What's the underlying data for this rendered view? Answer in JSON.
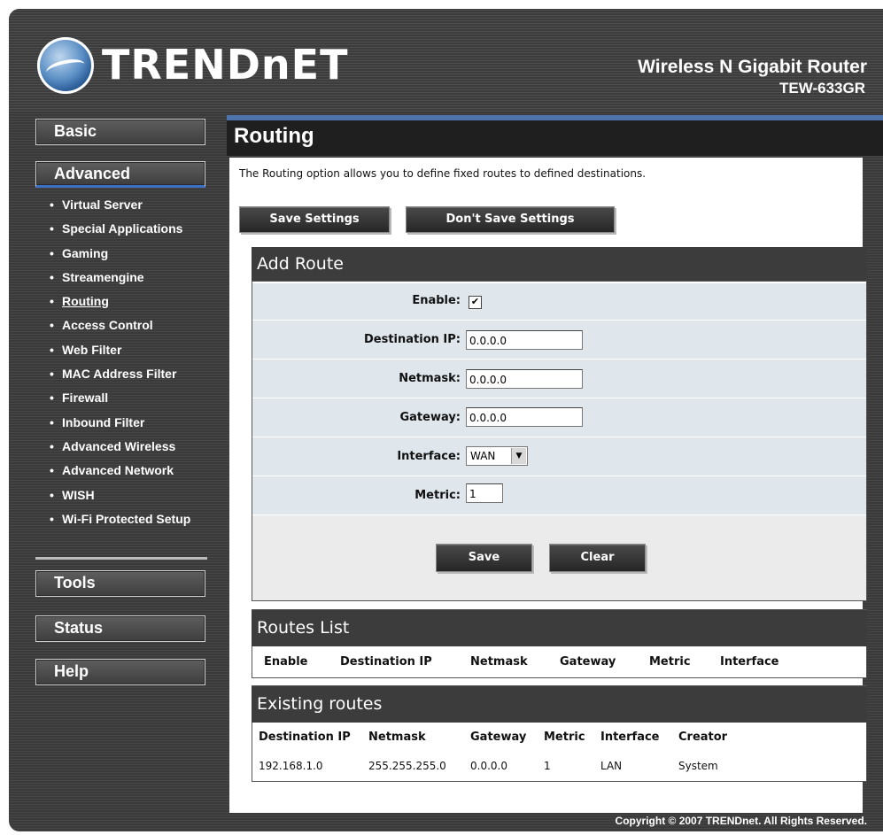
{
  "brand": {
    "logo_text": "TRENDnET",
    "product_title": "Wireless N Gigabit Router",
    "model": "TEW-633GR"
  },
  "nav": {
    "basic": "Basic",
    "advanced": "Advanced",
    "tools": "Tools",
    "status": "Status",
    "help": "Help",
    "advanced_items": [
      "Virtual Server",
      "Special Applications",
      "Gaming",
      "Streamengine",
      "Routing",
      "Access Control",
      "Web Filter",
      "MAC Address Filter",
      "Firewall",
      "Inbound Filter",
      "Advanced Wireless",
      "Advanced Network",
      "WISH",
      "Wi-Fi Protected Setup"
    ],
    "current_item": "Routing"
  },
  "page": {
    "title": "Routing",
    "intro": "The Routing option allows you to define fixed routes to defined destinations.",
    "save_settings": "Save Settings",
    "dont_save_settings": "Don't Save Settings"
  },
  "add_route": {
    "title": "Add Route",
    "enable_label": "Enable:",
    "enable_checked": true,
    "dest_label": "Destination IP:",
    "dest_value": "0.0.0.0",
    "netmask_label": "Netmask:",
    "netmask_value": "0.0.0.0",
    "gateway_label": "Gateway:",
    "gateway_value": "0.0.0.0",
    "interface_label": "Interface:",
    "interface_value": "WAN",
    "metric_label": "Metric:",
    "metric_value": "1",
    "save": "Save",
    "clear": "Clear"
  },
  "routes_list": {
    "title": "Routes List",
    "columns": [
      "Enable",
      "Destination IP",
      "Netmask",
      "Gateway",
      "Metric",
      "Interface"
    ]
  },
  "existing_routes": {
    "title": "Existing routes",
    "columns": [
      "Destination IP",
      "Netmask",
      "Gateway",
      "Metric",
      "Interface",
      "Creator"
    ],
    "rows": [
      [
        "192.168.1.0",
        "255.255.255.0",
        "0.0.0.0",
        "1",
        "LAN",
        "System"
      ]
    ]
  },
  "footer": "Copyright © 2007 TRENDnet. All Rights Reserved.",
  "colors": {
    "accent_blue": "#4f74ad",
    "row_bg": "#dfe6ec",
    "panel_header": "#3c3c3c"
  }
}
